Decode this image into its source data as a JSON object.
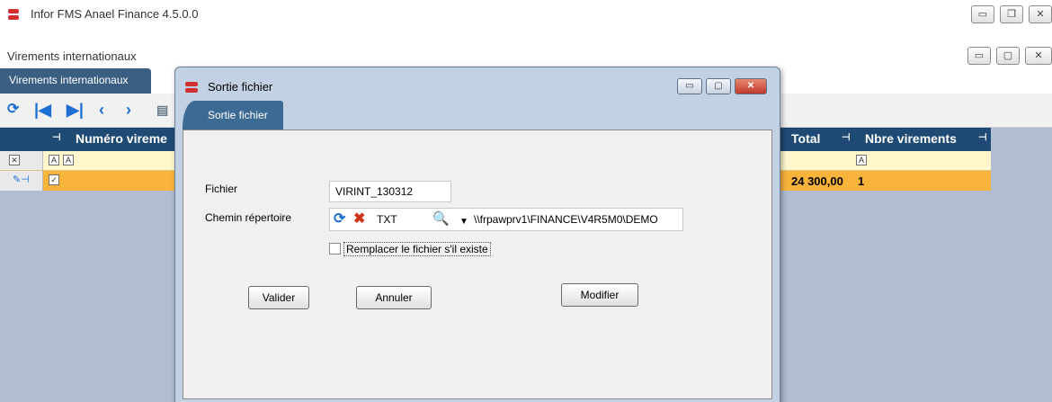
{
  "app": {
    "title": "Infor FMS Anael Finance 4.5.0.0",
    "window_controls": {
      "minimize": "▭",
      "restore": "❐",
      "close": "✕"
    }
  },
  "module": {
    "title": "Virements internationaux",
    "window_controls": {
      "minimize": "▭",
      "maximize": "▢",
      "close": "✕"
    }
  },
  "tabs": [
    {
      "label": "Virements internationaux",
      "active": true
    }
  ],
  "toolbar": {
    "icons": [
      "refresh-icon",
      "first-record-icon",
      "last-record-icon",
      "previous-record-icon",
      "next-record-icon",
      "export-icon"
    ]
  },
  "grid": {
    "columns": [
      {
        "label": "Numéro vireme"
      },
      {
        "label": "Total"
      },
      {
        "label": "Nbre virements"
      }
    ],
    "filter_marker": "A",
    "rows": [
      {
        "total": "24 300,00",
        "count": "1"
      }
    ]
  },
  "dialog": {
    "title": "Sortie fichier",
    "tab_label": "Sortie fichier",
    "fields": {
      "fichier_label": "Fichier",
      "fichier_value": "VIRINT_130312",
      "chemin_label": "Chemin répertoire",
      "format_value": "TXT",
      "path_value": "\\\\frpawprv1\\FINANCE\\V4R5M0\\DEMO"
    },
    "checkbox": {
      "label": "Remplacer le fichier s'il existe",
      "checked": false
    },
    "buttons": {
      "validate": "Valider",
      "cancel": "Annuler",
      "modify": "Modifier"
    },
    "controls": {
      "minimize": "▭",
      "maximize": "▢",
      "close": "✕"
    }
  },
  "colors": {
    "accent": "#1f4a73",
    "row_highlight": "#f8b33a",
    "workspace": "#b0bdd2",
    "dialog_frame": "#c3d1e4"
  }
}
